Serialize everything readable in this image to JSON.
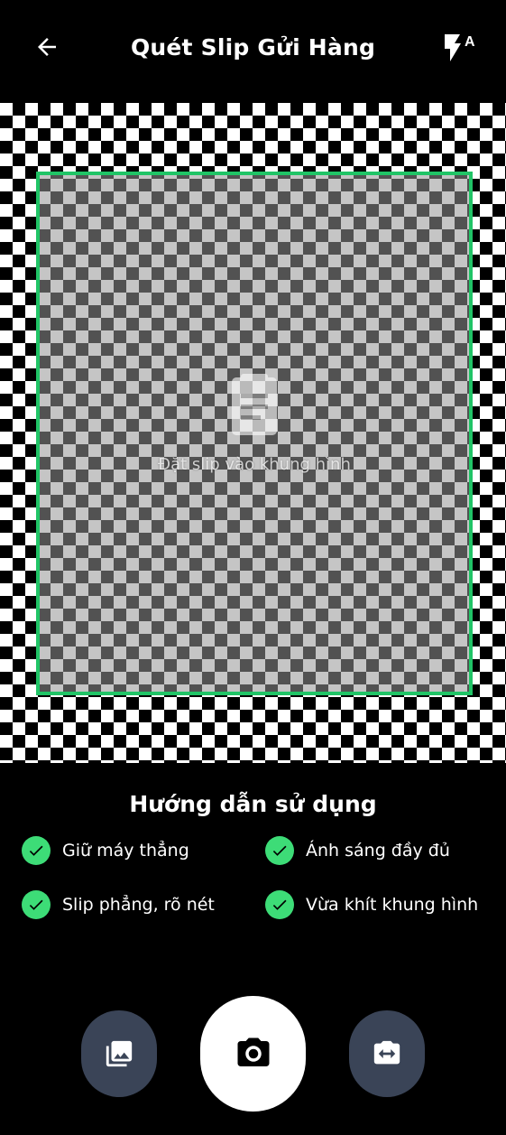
{
  "header": {
    "title": "Quét Slip Gửi Hàng",
    "back_icon": "arrow-left-icon",
    "flash_icon": "flash-auto-icon",
    "flash_badge": "A"
  },
  "preview": {
    "frame_color": "#20c466",
    "hint": "Đặt slip vào khung hình",
    "icon": "document-icon"
  },
  "guide": {
    "title": "Hướng dẫn sử dụng",
    "items": [
      {
        "label": "Giữ máy thẳng",
        "icon": "check-circle-icon"
      },
      {
        "label": "Ánh sáng đầy đủ",
        "icon": "check-circle-icon"
      },
      {
        "label": "Slip phẳng, rõ nét",
        "icon": "check-circle-icon"
      },
      {
        "label": "Vừa khít khung hình",
        "icon": "check-circle-icon"
      }
    ],
    "check_color": "#3ddc77"
  },
  "controls": {
    "gallery_icon": "gallery-icon",
    "shutter_icon": "camera-icon",
    "switch_icon": "camera-switch-icon",
    "side_button_color": "#3a4457"
  }
}
